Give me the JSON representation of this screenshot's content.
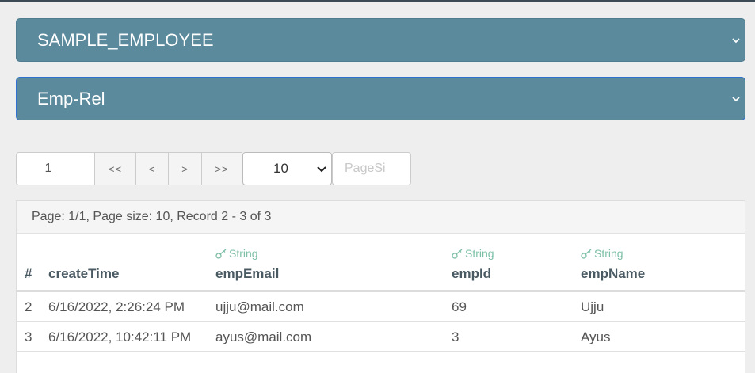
{
  "selects": {
    "table": "SAMPLE_EMPLOYEE",
    "relation": "Emp-Rel"
  },
  "pager": {
    "page_input": "1",
    "first": "<<",
    "prev": "<",
    "next": ">",
    "last": ">>",
    "page_size": "10",
    "custom_size_placeholder": "PageSi"
  },
  "table": {
    "info": "Page: 1/1, Page size: 10, Record 2 - 3 of 3",
    "columns": [
      {
        "label": "#",
        "type": ""
      },
      {
        "label": "createTime",
        "type": ""
      },
      {
        "label": "empEmail",
        "type": "String"
      },
      {
        "label": "empId",
        "type": "String"
      },
      {
        "label": "empName",
        "type": "String"
      }
    ],
    "rows": [
      [
        "2",
        "6/16/2022, 2:26:24 PM",
        "ujju@mail.com",
        "69",
        "Ujju"
      ],
      [
        "3",
        "6/16/2022, 10:42:11 PM",
        "ayus@mail.com",
        "3",
        "Ayus"
      ]
    ]
  },
  "colors": {
    "select_bg": "#5a8a9c",
    "type_accent": "#7cbfa6"
  },
  "icons": {
    "select_chevron": "chevron-down-icon",
    "type_tag": "key-icon"
  }
}
